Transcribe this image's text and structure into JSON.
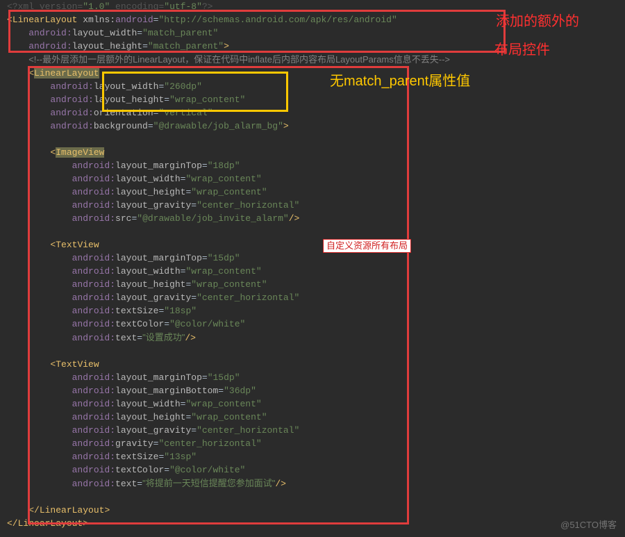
{
  "annotations": {
    "red1": "添加的额外的",
    "red2": "布局控件",
    "yellow": "无match_parent属性值",
    "whiteLabel": "自定义资源所有布局",
    "watermark": "@51CTO博客"
  },
  "code": {
    "l0": {
      "decl1": "<?",
      "decl2": "xml version=",
      "decl3": "\"1.0\"",
      "decl4": " encoding=",
      "decl5": "\"utf-8\"",
      "decl6": "?>"
    },
    "l1": {
      "open": "<",
      "tag": "LinearLayout",
      "sp": " ",
      "nsk": "xmlns:",
      "nsn": "android",
      "eq": "=",
      "url": "\"http://schemas.android.com/apk/res/android\""
    },
    "l2": {
      "ns": "android:",
      "attr": "layout_width",
      "eq": "=",
      "val": "\"match_parent\""
    },
    "l3": {
      "ns": "android:",
      "attr": "layout_height",
      "eq": "=",
      "val": "\"match_parent\"",
      "close": ">"
    },
    "l4": {
      "comment": "<!--最外层添加一层额外的LinearLayout，保证在代码中inflate后内部内容布局LayoutParams信息不丢失-->"
    },
    "l5": {
      "open": "<",
      "tag": "LinearLayout"
    },
    "l6": {
      "ns": "android:",
      "attr": "layout_width",
      "eq": "=",
      "val": "\"260dp\""
    },
    "l7": {
      "ns": "android:",
      "attr": "layout_height",
      "eq": "=",
      "val": "\"wrap_content\""
    },
    "l8": {
      "ns": "android:",
      "attr": "orientation",
      "eq": "=",
      "val": "\"vertical\""
    },
    "l9": {
      "ns": "android:",
      "attr": "background",
      "eq": "=",
      "val": "\"@drawable/job_alarm_bg\"",
      "close": ">"
    },
    "l11": {
      "open": "<",
      "tag": "ImageView"
    },
    "l12": {
      "ns": "android:",
      "attr": "layout_marginTop",
      "eq": "=",
      "val": "\"18dp\""
    },
    "l13": {
      "ns": "android:",
      "attr": "layout_width",
      "eq": "=",
      "val": "\"wrap_content\""
    },
    "l14": {
      "ns": "android:",
      "attr": "layout_height",
      "eq": "=",
      "val": "\"wrap_content\""
    },
    "l15": {
      "ns": "android:",
      "attr": "layout_gravity",
      "eq": "=",
      "val": "\"center_horizontal\""
    },
    "l16": {
      "ns": "android:",
      "attr": "src",
      "eq": "=",
      "val": "\"@drawable/job_invite_alarm\"",
      "close": "/>"
    },
    "l18": {
      "open": "<",
      "tag": "TextView"
    },
    "l19": {
      "ns": "android:",
      "attr": "layout_marginTop",
      "eq": "=",
      "val": "\"15dp\""
    },
    "l20": {
      "ns": "android:",
      "attr": "layout_width",
      "eq": "=",
      "val": "\"wrap_content\""
    },
    "l21": {
      "ns": "android:",
      "attr": "layout_height",
      "eq": "=",
      "val": "\"wrap_content\""
    },
    "l22": {
      "ns": "android:",
      "attr": "layout_gravity",
      "eq": "=",
      "val": "\"center_horizontal\""
    },
    "l23": {
      "ns": "android:",
      "attr": "textSize",
      "eq": "=",
      "val": "\"18sp\""
    },
    "l24": {
      "ns": "android:",
      "attr": "textColor",
      "eq": "=",
      "val": "\"@color/white\""
    },
    "l25": {
      "ns": "android:",
      "attr": "text",
      "eq": "=",
      "val": "\"设置成功\"",
      "close": "/>"
    },
    "l27": {
      "open": "<",
      "tag": "TextView"
    },
    "l28": {
      "ns": "android:",
      "attr": "layout_marginTop",
      "eq": "=",
      "val": "\"15dp\""
    },
    "l29": {
      "ns": "android:",
      "attr": "layout_marginBottom",
      "eq": "=",
      "val": "\"36dp\""
    },
    "l30": {
      "ns": "android:",
      "attr": "layout_width",
      "eq": "=",
      "val": "\"wrap_content\""
    },
    "l31": {
      "ns": "android:",
      "attr": "layout_height",
      "eq": "=",
      "val": "\"wrap_content\""
    },
    "l32": {
      "ns": "android:",
      "attr": "layout_gravity",
      "eq": "=",
      "val": "\"center_horizontal\""
    },
    "l33": {
      "ns": "android:",
      "attr": "gravity",
      "eq": "=",
      "val": "\"center_horizontal\""
    },
    "l34": {
      "ns": "android:",
      "attr": "textSize",
      "eq": "=",
      "val": "\"13sp\""
    },
    "l35": {
      "ns": "android:",
      "attr": "textColor",
      "eq": "=",
      "val": "\"@color/white\""
    },
    "l36": {
      "ns": "android:",
      "attr": "text",
      "eq": "=",
      "val": "\"将提前一天短信提醒您参加面试\"",
      "close": "/>"
    },
    "l38": {
      "close": "</",
      "tag": "LinearLayout",
      "end": ">"
    },
    "l39": {
      "close": "</",
      "tag": "LinearLayout",
      "end": ">"
    }
  }
}
